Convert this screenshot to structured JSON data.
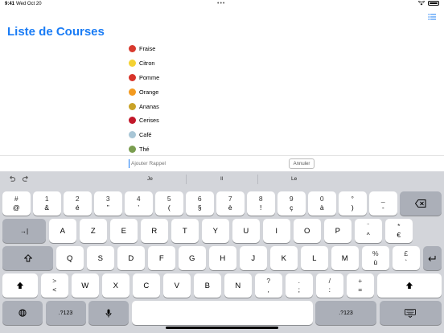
{
  "status_bar": {
    "time": "9:41",
    "date": "Wed Oct 20"
  },
  "header": {
    "title": "Liste de Courses"
  },
  "list": {
    "items": [
      {
        "label": "Fraise",
        "icon": "strawberry-icon",
        "color": "#d83a2e"
      },
      {
        "label": "Citron",
        "icon": "lemon-icon",
        "color": "#f4d233"
      },
      {
        "label": "Pomme",
        "icon": "apple-icon",
        "color": "#d8342a"
      },
      {
        "label": "Orange",
        "icon": "orange-icon",
        "color": "#f39a1f"
      },
      {
        "label": "Ananas",
        "icon": "pineapple-icon",
        "color": "#c9a227"
      },
      {
        "label": "Cerises",
        "icon": "cherries-icon",
        "color": "#c2182a"
      },
      {
        "label": "Café",
        "icon": "coffee-icon",
        "color": "#a8c6d6"
      },
      {
        "label": "Thé",
        "icon": "tea-icon",
        "color": "#7a9d4f"
      }
    ]
  },
  "reminder": {
    "placeholder": "Ajouter Rappel",
    "cancel_label": "Annuler"
  },
  "keyboard": {
    "suggestions": [
      "Je",
      "Il",
      "Le"
    ],
    "row1": [
      {
        "top": "#",
        "bottom": "@"
      },
      {
        "top": "1",
        "bottom": "&"
      },
      {
        "top": "2",
        "bottom": "é"
      },
      {
        "top": "3",
        "bottom": "”"
      },
      {
        "top": "4",
        "bottom": "’"
      },
      {
        "top": "5",
        "bottom": "("
      },
      {
        "top": "6",
        "bottom": "§"
      },
      {
        "top": "7",
        "bottom": "è"
      },
      {
        "top": "8",
        "bottom": "!"
      },
      {
        "top": "9",
        "bottom": "ç"
      },
      {
        "top": "0",
        "bottom": "à"
      },
      {
        "top": "°",
        "bottom": ")"
      },
      {
        "top": "_",
        "bottom": "-"
      }
    ],
    "row2": [
      "A",
      "Z",
      "E",
      "R",
      "T",
      "Y",
      "U",
      "I",
      "O",
      "P"
    ],
    "row2_extra": [
      {
        "top": "¨",
        "bottom": "^"
      },
      {
        "top": "*",
        "bottom": "€"
      }
    ],
    "row3": [
      "Q",
      "S",
      "D",
      "F",
      "G",
      "H",
      "J",
      "K",
      "L",
      "M"
    ],
    "row3_extra": [
      {
        "top": "%",
        "bottom": "ù"
      },
      {
        "top": "£",
        "bottom": "`"
      }
    ],
    "row4": [
      "W",
      "X",
      "C",
      "V",
      "B",
      "N"
    ],
    "row4_left": {
      "top": ">",
      "bottom": "<"
    },
    "row4_extra": [
      {
        "top": "?",
        "bottom": ","
      },
      {
        "top": ".",
        "bottom": ";"
      },
      {
        "top": "/",
        "bottom": ":"
      },
      {
        "top": "+",
        "bottom": "="
      }
    ],
    "numbers_label": ".?123"
  }
}
